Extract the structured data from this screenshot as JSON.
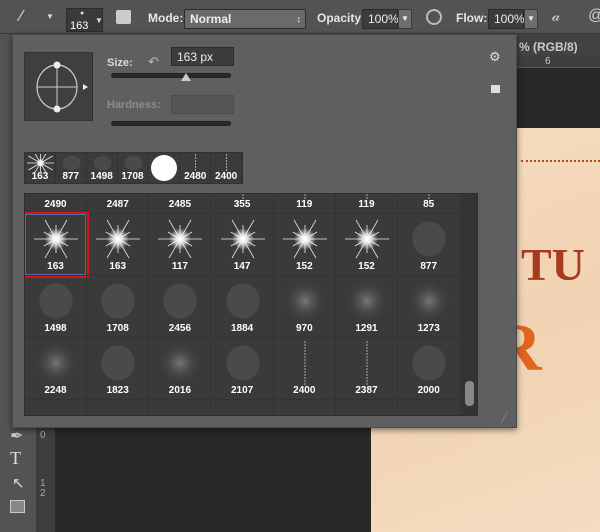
{
  "toolbar": {
    "brush_size": "163",
    "mode_label": "Mode:",
    "mode_value": "Normal",
    "opacity_label": "Opacity:",
    "opacity_value": "100%",
    "flow_label": "Flow:",
    "flow_value": "100%"
  },
  "document": {
    "tab_title": "% (RGB/8)",
    "ruler_top_tick": "6",
    "ruler_left_ticks": [
      "0",
      "1",
      "2"
    ]
  },
  "brush_panel": {
    "size_label": "Size:",
    "size_value": "163 px",
    "size_slider_fraction": 0.62,
    "hardness_label": "Hardness:",
    "hardness_value": "",
    "recent_brushes": [
      {
        "size": "163",
        "type": "star"
      },
      {
        "size": "877",
        "type": "noise"
      },
      {
        "size": "1498",
        "type": "noise"
      },
      {
        "size": "1708",
        "type": "noise"
      },
      {
        "size": "",
        "type": "hard"
      },
      {
        "size": "2480",
        "type": "line"
      },
      {
        "size": "2400",
        "type": "line"
      }
    ],
    "presets": [
      [
        {
          "size": "2490",
          "type": "noise"
        },
        {
          "size": "2487",
          "type": "noise"
        },
        {
          "size": "2485",
          "type": "noise"
        },
        {
          "size": "355",
          "type": "line"
        },
        {
          "size": "119",
          "type": "line"
        },
        {
          "size": "119",
          "type": "line"
        },
        {
          "size": "85",
          "type": "line"
        }
      ],
      [
        {
          "size": "163",
          "type": "star",
          "selected": true
        },
        {
          "size": "163",
          "type": "star"
        },
        {
          "size": "117",
          "type": "star"
        },
        {
          "size": "147",
          "type": "star"
        },
        {
          "size": "152",
          "type": "star"
        },
        {
          "size": "152",
          "type": "star"
        },
        {
          "size": "877",
          "type": "noise"
        }
      ],
      [
        {
          "size": "1498",
          "type": "noise"
        },
        {
          "size": "1708",
          "type": "noise"
        },
        {
          "size": "2456",
          "type": "noise"
        },
        {
          "size": "1884",
          "type": "noise"
        },
        {
          "size": "970",
          "type": "soft"
        },
        {
          "size": "1291",
          "type": "soft"
        },
        {
          "size": "1273",
          "type": "soft"
        }
      ],
      [
        {
          "size": "2248",
          "type": "soft"
        },
        {
          "size": "1823",
          "type": "noise"
        },
        {
          "size": "2016",
          "type": "soft"
        },
        {
          "size": "2107",
          "type": "noise"
        },
        {
          "size": "2400",
          "type": "line"
        },
        {
          "size": "2387",
          "type": "line"
        },
        {
          "size": "2000",
          "type": "noise"
        }
      ]
    ]
  },
  "colors": {
    "selection": "#e01010",
    "panel": "#5f5f5f",
    "paper": "#f3d9bd"
  }
}
